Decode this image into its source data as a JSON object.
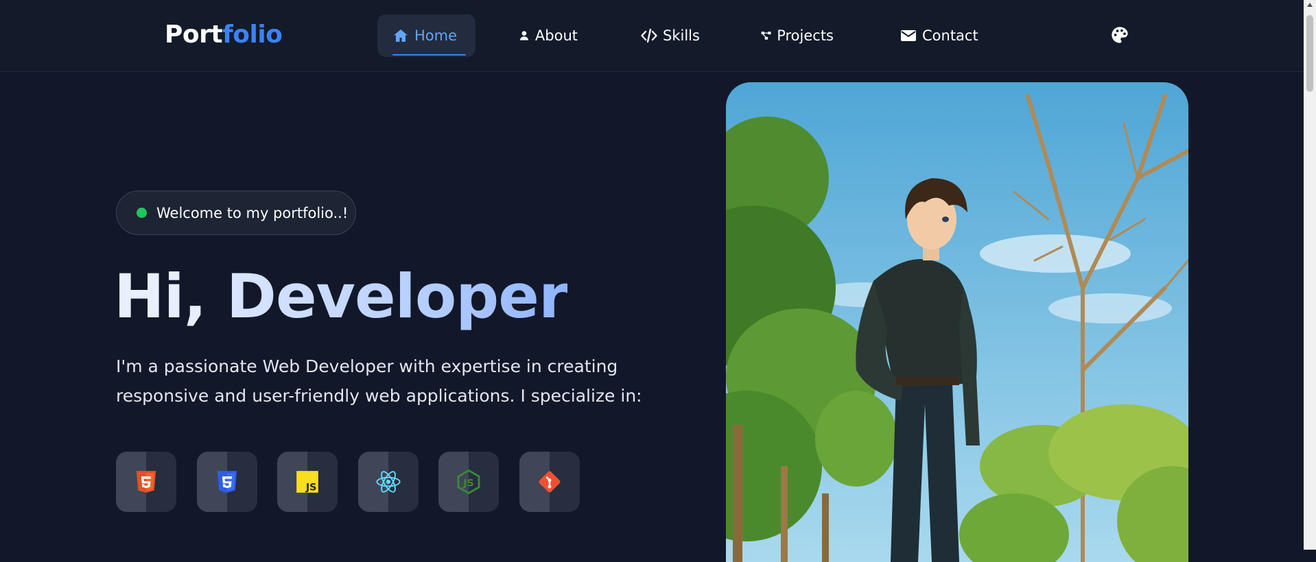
{
  "logo": {
    "part1": "Port",
    "part2": "folio"
  },
  "nav": {
    "items": [
      {
        "label": "Home",
        "icon": "home-icon",
        "active": true
      },
      {
        "label": "About",
        "icon": "user-icon",
        "active": false
      },
      {
        "label": "Skills",
        "icon": "code-icon",
        "active": false
      },
      {
        "label": "Projects",
        "icon": "project-diagram-icon",
        "active": false
      },
      {
        "label": "Contact",
        "icon": "envelope-icon",
        "active": false
      }
    ],
    "theme_icon": "palette-icon"
  },
  "hero": {
    "badge": "Welcome to my portfolio..!",
    "title_greeting": "Hi,",
    "title_name": "Developer",
    "description": "I'm a passionate Web Developer with expertise in creating responsive and user-friendly web applications. I specialize in:",
    "skills": [
      {
        "icon": "html5-icon",
        "color": "#e34f26"
      },
      {
        "icon": "css3-icon",
        "color": "#2f5bea"
      },
      {
        "icon": "javascript-icon",
        "color": "#f7df1e"
      },
      {
        "icon": "react-icon",
        "color": "#61dafb"
      },
      {
        "icon": "nodejs-icon",
        "color": "#3c873a"
      },
      {
        "icon": "git-icon",
        "color": "#f05032"
      }
    ]
  },
  "colors": {
    "background": "#121829",
    "accent": "#3b82f6",
    "status_dot": "#22c55e"
  }
}
